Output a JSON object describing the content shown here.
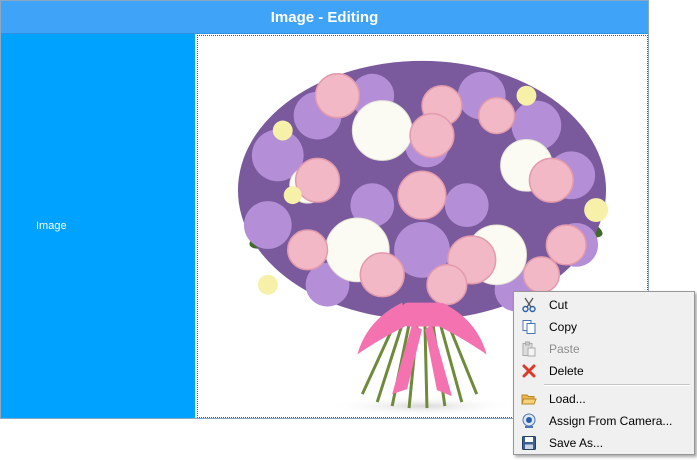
{
  "window": {
    "title": "Image - Editing"
  },
  "field": {
    "label": "Image"
  },
  "context_menu": {
    "items": [
      {
        "label": "Cut",
        "icon": "scissors-icon",
        "enabled": true
      },
      {
        "label": "Copy",
        "icon": "copy-icon",
        "enabled": true
      },
      {
        "label": "Paste",
        "icon": "paste-icon",
        "enabled": false
      },
      {
        "label": "Delete",
        "icon": "delete-icon",
        "enabled": true
      },
      {
        "label": "Load...",
        "icon": "folder-open-icon",
        "enabled": true
      },
      {
        "label": "Assign From Camera...",
        "icon": "camera-icon",
        "enabled": true
      },
      {
        "label": "Save As...",
        "icon": "floppy-disk-icon",
        "enabled": true
      }
    ]
  },
  "colors": {
    "titlebar": "#3fa3f7",
    "label_panel": "#00a2ff",
    "menu_background": "#f0f0f0"
  }
}
